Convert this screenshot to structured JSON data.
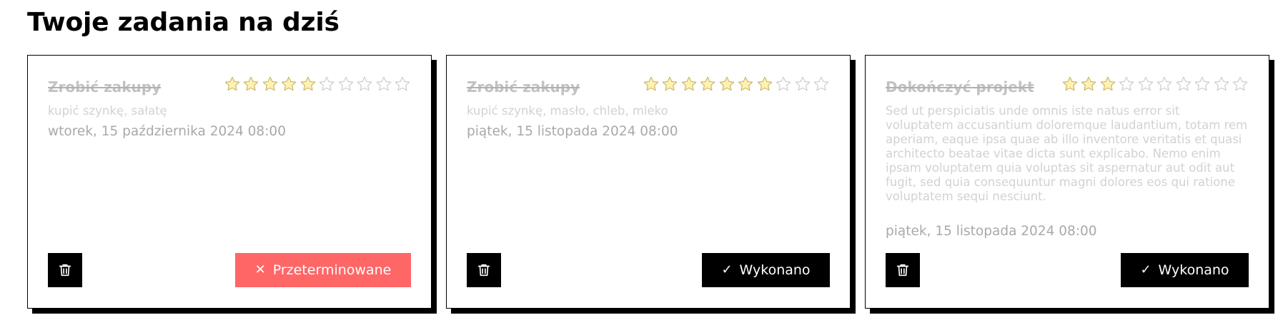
{
  "page": {
    "heading": "Twoje zadania na dziś"
  },
  "colors": {
    "star_filled": "#FFF2B0",
    "star_empty": "#ffffff",
    "star_stroke": "#c6b26a",
    "overdue": "#ff6666",
    "done": "#000000"
  },
  "tasks": [
    {
      "title": "Zrobić zakupy",
      "rating": 5,
      "max_rating": 10,
      "description": "kupić szynkę, sałatę",
      "date": "wtorek, 15 października 2024 08:00",
      "delete_icon": "trash-icon",
      "status": {
        "type": "overdue",
        "icon": "close-icon",
        "glyph": "✕",
        "label": "Przeterminowane"
      }
    },
    {
      "title": "Zrobić zakupy",
      "rating": 7,
      "max_rating": 10,
      "description": "kupić szynkę, masło, chleb, mleko",
      "date": "piątek, 15 listopada 2024 08:00",
      "delete_icon": "trash-icon",
      "status": {
        "type": "done",
        "icon": "checkmark-icon",
        "glyph": "✓",
        "label": "Wykonano"
      }
    },
    {
      "title": "Dokończyć projekt",
      "rating": 3,
      "max_rating": 10,
      "description": "Sed ut perspiciatis unde omnis iste natus error sit voluptatem accusantium doloremque laudantium, totam rem aperiam, eaque ipsa quae ab illo inventore veritatis et quasi architecto beatae vitae dicta sunt explicabo. Nemo enim ipsam voluptatem quia voluptas sit aspernatur aut odit aut fugit, sed quia consequuntur magni dolores eos qui ratione voluptatem sequi nesciunt.",
      "date": "piątek, 15 listopada 2024 08:00",
      "delete_icon": "trash-icon",
      "status": {
        "type": "done",
        "icon": "checkmark-icon",
        "glyph": "✓",
        "label": "Wykonano"
      }
    }
  ]
}
